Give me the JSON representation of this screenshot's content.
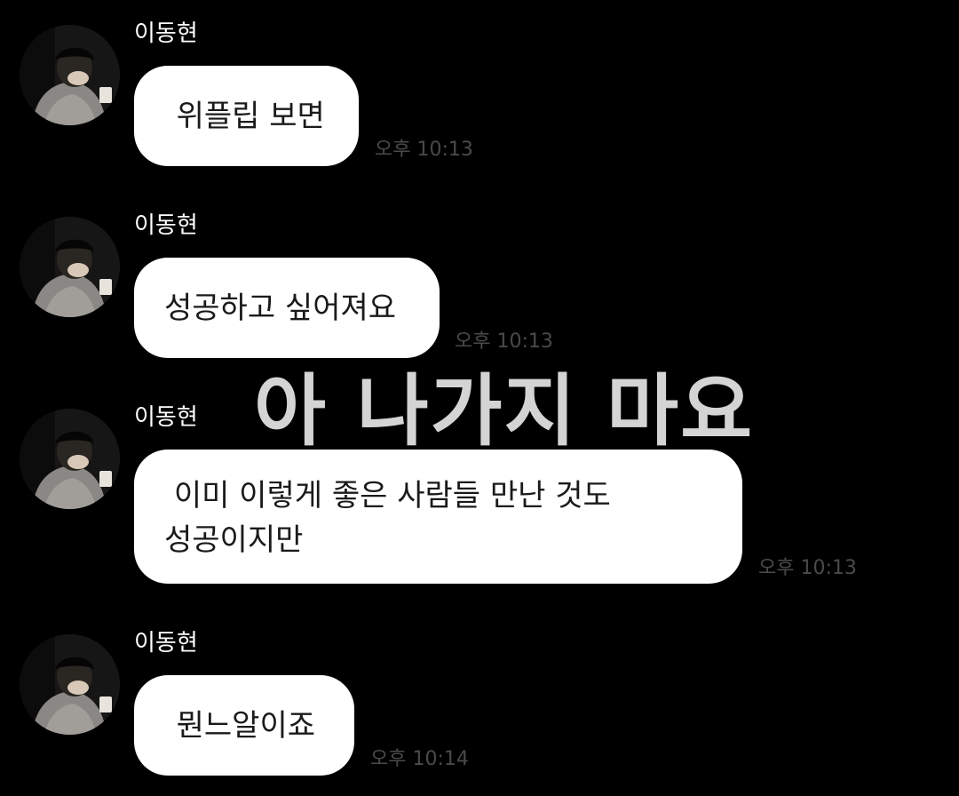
{
  "caption": "아 나가지 마요",
  "messages": [
    {
      "sender": "이동현",
      "text": "  위플립 보면",
      "time": "오후 10:13"
    },
    {
      "sender": "이동현",
      "text": "성공하고 싶어져요",
      "time": "오후 10:13"
    },
    {
      "sender": "이동현",
      "text": " 이미 이렇게 좋은 사람들 만난 것도\n성공이지만",
      "time": "오후 10:13"
    },
    {
      "sender": "이동현",
      "text": "  뭔느알이죠",
      "time": "오후 10:14"
    }
  ],
  "colors": {
    "background": "#000000",
    "bubble": "#ffffff",
    "bubble_text": "#1a1a1a",
    "sender_text": "#ffffff",
    "timestamp_text": "#4a4a4a",
    "caption_text": "#e6e6e6"
  },
  "icons": {
    "avatar": "profile-photo-avatar"
  }
}
